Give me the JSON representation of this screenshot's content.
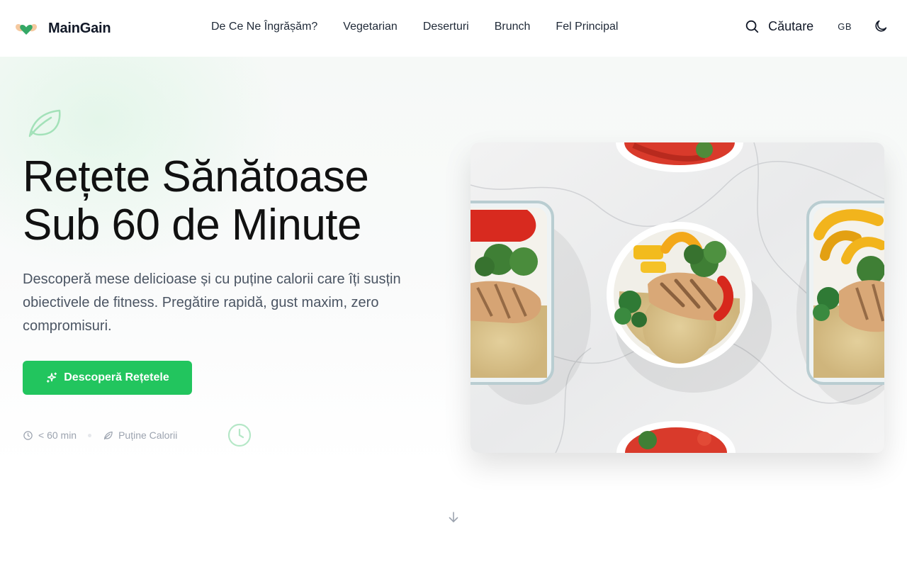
{
  "header": {
    "brand": "MainGain",
    "nav": [
      "De Ce Ne Îngrășăm?",
      "Vegetarian",
      "Deserturi",
      "Brunch",
      "Fel Principal"
    ],
    "search_label": "Căutare",
    "language": "GB",
    "icons": {
      "logo": "heart-hands-logo",
      "search": "search-icon",
      "theme": "moon-icon"
    }
  },
  "hero": {
    "title_line1": "Rețete Sănătoase",
    "title_line2": "Sub 60 de Minute",
    "description": "Descoperă mese delicioase și cu puține calorii care îți susțin obiectivele de fitness. Pregătire rapidă, gust maxim, zero compromisuri.",
    "cta_label": "Descoperă Rețetele",
    "meta": [
      {
        "icon": "clock-icon",
        "label": "< 60 min"
      },
      {
        "icon": "leaf-icon",
        "label": "Puține Calorii"
      }
    ],
    "image_alt": "Healthy meal bowls with grilled chicken, quinoa and vegetables"
  },
  "colors": {
    "accent": "#22c55e",
    "text": "#111827",
    "muted": "#4b5563",
    "meta": "#9ca3af"
  }
}
